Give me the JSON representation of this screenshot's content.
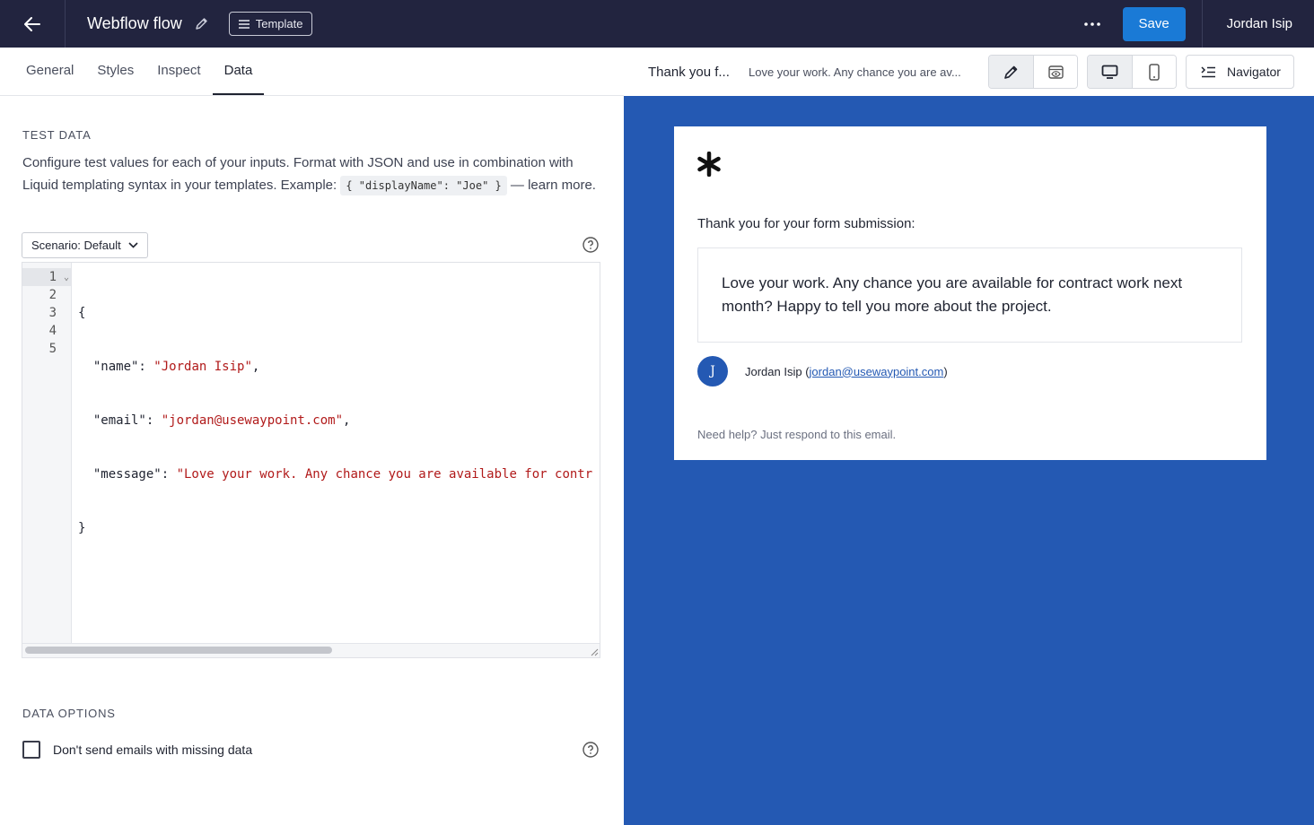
{
  "topbar": {
    "back_icon": "arrow-left-icon",
    "flow_title": "Webflow flow",
    "template_label": "Template",
    "more_icon": "ellipsis-icon",
    "save_label": "Save",
    "user_name": "Jordan Isip",
    "brand_color": "#22243f",
    "save_color": "#1a7ad6"
  },
  "tabs": [
    {
      "label": "General",
      "active": false
    },
    {
      "label": "Styles",
      "active": false
    },
    {
      "label": "Inspect",
      "active": false
    },
    {
      "label": "Data",
      "active": true
    }
  ],
  "test_data": {
    "heading": "TEST DATA",
    "description_before": "Configure test values for each of your inputs. Format with JSON and use in combination with Liquid templating syntax in your templates. Example: ",
    "example_code": "{ \"displayName\": \"Joe\" }",
    "description_after": " — learn more.",
    "scenario_label": "Scenario: Default",
    "line_numbers": [
      "1",
      "2",
      "3",
      "4",
      "5"
    ],
    "code": {
      "open": "{",
      "name_key": "  \"name\": ",
      "name_val": "\"Jordan Isip\"",
      "email_key": "  \"email\": ",
      "email_val": "\"jordan@usewaypoint.com\"",
      "message_key": "  \"message\": ",
      "message_val": "\"Love your work. Any chance you are available for contr",
      "comma": ",",
      "close": "}"
    }
  },
  "data_options": {
    "heading": "DATA OPTIONS",
    "missing_data_label": "Don't send emails with missing data",
    "missing_data_checked": false
  },
  "preview_toolbar": {
    "subject": "Thank you f...",
    "preview_text": "Love your work. Any chance you are av...",
    "navigator_label": "Navigator"
  },
  "email": {
    "background_color": "#2459b3",
    "logo_icon": "asterisk-icon",
    "intro": "Thank you for your form submission:",
    "message": "Love your work. Any chance you are available for contract work next month? Happy to tell you more about the project.",
    "avatar_initial": "J",
    "sender_name": "Jordan Isip",
    "sender_email": "jordan@usewaypoint.com",
    "footer": "Need help? Just respond to this email."
  }
}
